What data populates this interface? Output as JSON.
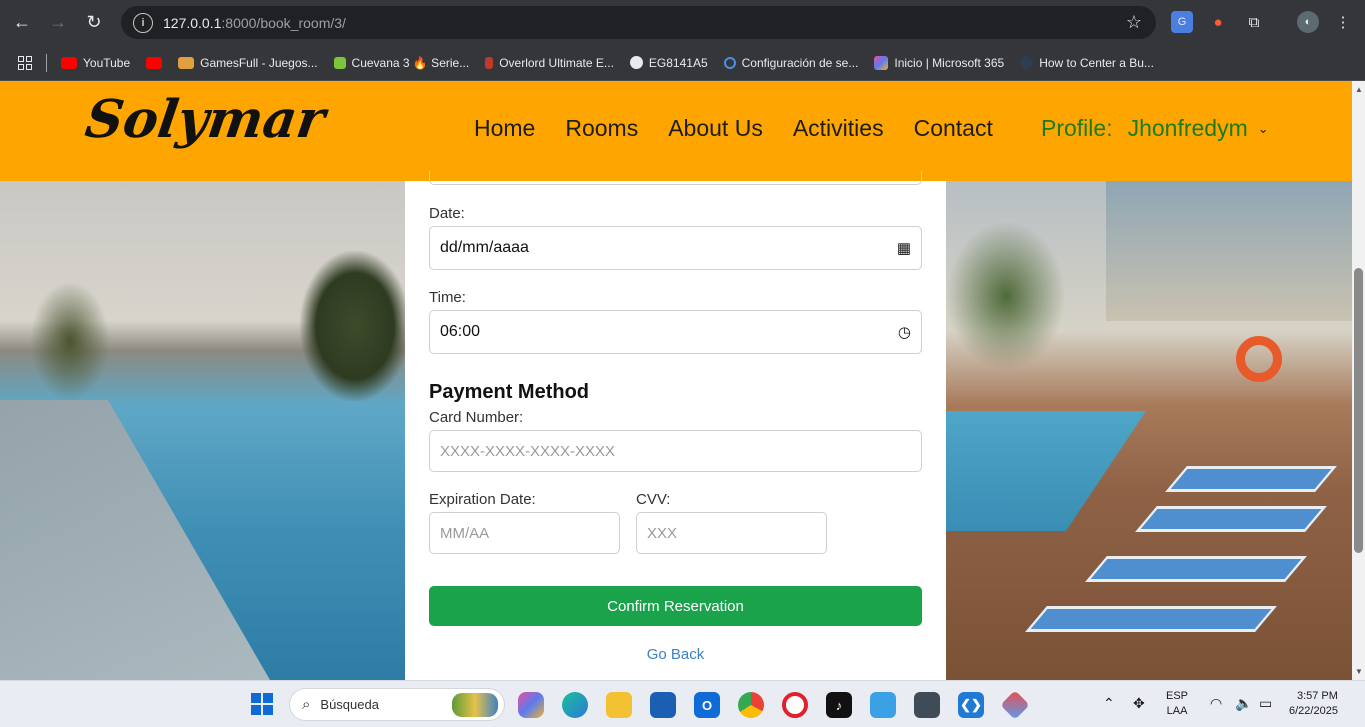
{
  "browser": {
    "url_host": "127.0.0.1",
    "url_path": ":8000/book_room/3/",
    "bookmarks": [
      {
        "label": "YouTube",
        "color": "#ff0000"
      },
      {
        "label": "",
        "color": "#ff0000"
      },
      {
        "label": "GamesFull - Juegos...",
        "color": "#e0a040"
      },
      {
        "label": "Cuevana 3 🔥 Serie...",
        "color": "#7cc43b"
      },
      {
        "label": "Overlord Ultimate E...",
        "color": "#c0392b"
      },
      {
        "label": "EG8141A5",
        "color": "#e8eaed"
      },
      {
        "label": "Configuración de se...",
        "color": "#4a90e2"
      },
      {
        "label": "Inicio | Microsoft 365",
        "color": "#9b59b6"
      },
      {
        "label": "How to Center a Bu...",
        "color": "#2c3e50"
      }
    ]
  },
  "site": {
    "logo": "Solymar",
    "nav": [
      "Home",
      "Rooms",
      "About Us",
      "Activities",
      "Contact"
    ],
    "profile_label": "Profile:",
    "profile_user": "Jhonfredym"
  },
  "form": {
    "date_label": "Date:",
    "date_value": "dd/mm/aaaa",
    "time_label": "Time:",
    "time_value": "06:00",
    "payment_title": "Payment Method",
    "card_label": "Card Number:",
    "card_placeholder": "XXXX-XXXX-XXXX-XXXX",
    "exp_label": "Expiration Date:",
    "exp_placeholder": "MM/AA",
    "cvv_label": "CVV:",
    "cvv_placeholder": "XXX",
    "confirm_label": "Confirm Reservation",
    "back_label": "Go Back"
  },
  "taskbar": {
    "search_placeholder": "Búsqueda",
    "lang_top": "ESP",
    "lang_bottom": "LAA",
    "time": "3:57 PM",
    "date": "6/22/2025"
  },
  "colors": {
    "header": "#fea500",
    "confirm": "#1aa34a",
    "profile": "#1c7b1c",
    "link": "#3b82c4"
  }
}
